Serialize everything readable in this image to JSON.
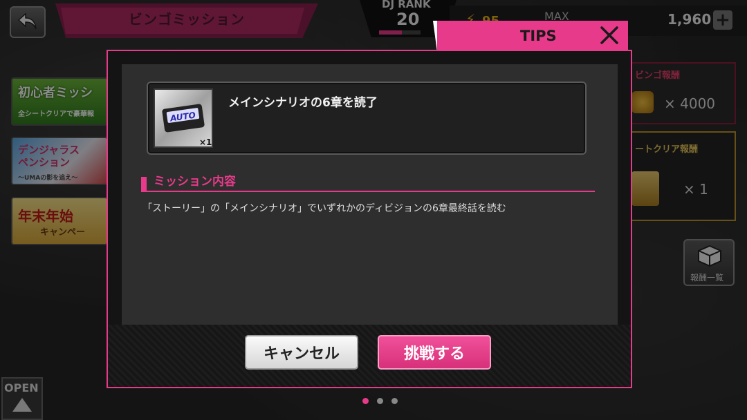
{
  "header": {
    "title": "ビンゴミッション",
    "dj_rank_label": "DJ RANK",
    "dj_rank_value": "20",
    "dj_rank_progress": 0.55,
    "stamina": "95",
    "max_label": "MAX",
    "coins": "1,960"
  },
  "side_banners": [
    {
      "line1": "初心者ミッシ",
      "line2": "全シートクリアで豪華報"
    },
    {
      "line1": "デンジャラス",
      "line2": "ペンション",
      "line3": "～UMAの影を追え～"
    },
    {
      "line1": "年末年始",
      "line2": "キャンペー"
    }
  ],
  "rewards": {
    "bingo_title": "ビンゴ報酬",
    "bingo_qty": "× 4000",
    "sheet_title": "ートクリア報酬",
    "sheet_qty": "× 1",
    "list_label": "報酬一覧"
  },
  "open_label": "OPEN",
  "pagination": {
    "count": 3,
    "active": 0
  },
  "tips": {
    "label": "TIPS"
  },
  "dialog": {
    "item_title": "メインシナリオの6章を読了",
    "item_tag": "AUTO",
    "item_qty": "×1",
    "section_title": "ミッション内容",
    "description": "「ストーリー」の「メインシナリオ」でいずれかのディビジョンの6章最終話を読む",
    "cancel_label": "キャンセル",
    "challenge_label": "挑戦する"
  },
  "colors": {
    "accent": "#e83a8a",
    "banner": "#b02a63"
  }
}
